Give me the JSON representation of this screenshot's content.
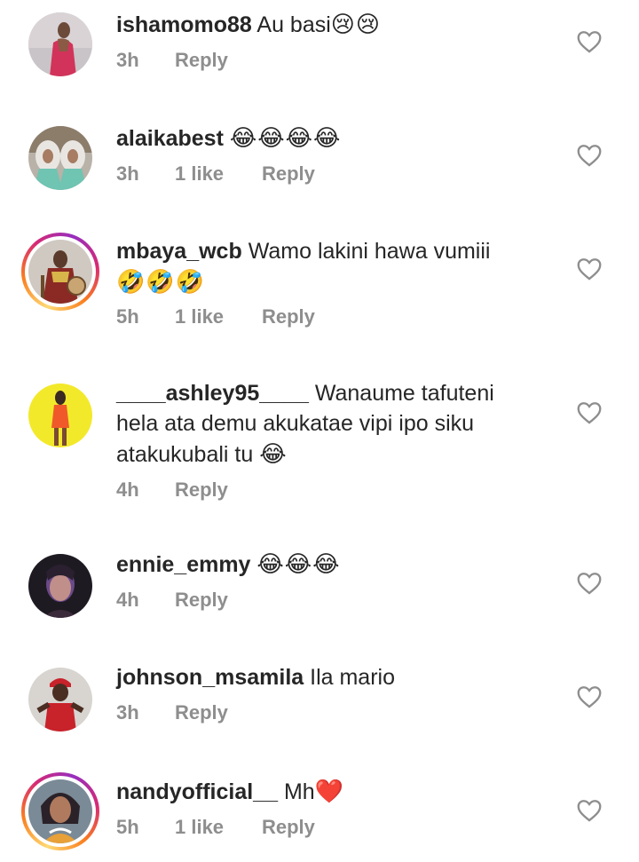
{
  "comments": [
    {
      "username": "ishamomo88",
      "text": " Au basi",
      "emoji": "😢😢",
      "time": "3h",
      "likes": "",
      "reply": "Reply",
      "avatar_icon": "woman-pink-dress-photo",
      "story_ring": false
    },
    {
      "username": "alaikabest",
      "text": " ",
      "emoji": "😂😂😂😂",
      "time": "3h",
      "likes": "1 like",
      "reply": "Reply",
      "avatar_icon": "two-women-hijab-photo",
      "story_ring": false
    },
    {
      "username": "mbaya_wcb",
      "text": " Wamo lakini hawa vumiii",
      "line2": "🤣🤣🤣",
      "time": "5h",
      "likes": "1 like",
      "reply": "Reply",
      "avatar_icon": "man-traditional-attire-photo",
      "story_ring": true
    },
    {
      "username": "____ashley95____",
      "text": " Wanaume tafuteni",
      "line2": "hela ata demu akukatae vipi ipo siku",
      "line3": "atakukubali tu ",
      "line3_emoji": "😂",
      "time": "4h",
      "likes": "",
      "reply": "Reply",
      "avatar_icon": "woman-orange-dress-yellow-bg-photo",
      "story_ring": false
    },
    {
      "username": "ennie_emmy",
      "text": " ",
      "emoji": "😂😂😂",
      "time": "4h",
      "likes": "",
      "reply": "Reply",
      "avatar_icon": "woman-selfie-dark-photo",
      "story_ring": false
    },
    {
      "username": "johnson_msamila",
      "text": " Ila mario",
      "time": "3h",
      "likes": "",
      "reply": "Reply",
      "avatar_icon": "man-red-cap-photo",
      "story_ring": false
    },
    {
      "username": "nandyofficial__",
      "text": " Mh",
      "emoji": "❤️",
      "time": "5h",
      "likes": "1 like",
      "reply": "Reply",
      "avatar_icon": "woman-portrait-glam-photo",
      "story_ring": true
    }
  ],
  "colors": {
    "text": "#262626",
    "meta": "#8e8e8e",
    "heart_outline": "#8e8e8e"
  },
  "heart_icon": "like-heart-outline-icon"
}
